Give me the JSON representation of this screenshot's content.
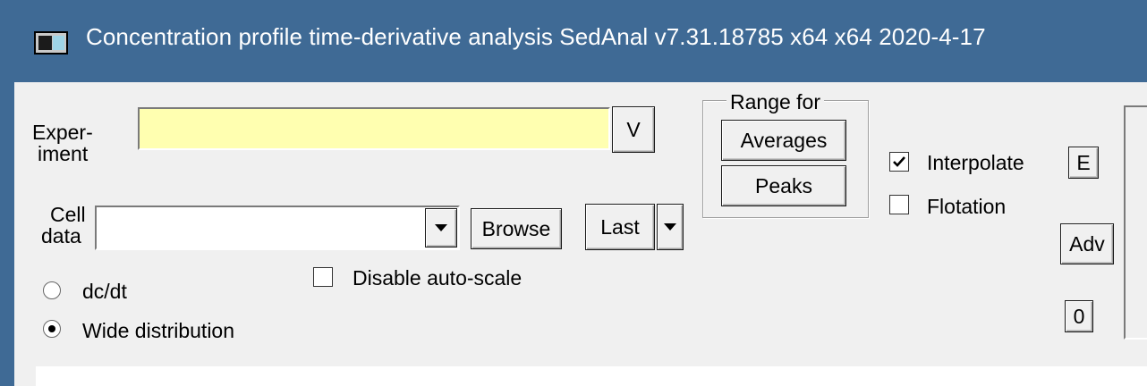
{
  "window": {
    "title": "Concentration profile time-derivative analysis   SedAnal v7.31.18785 x64 x64 2020-4-17"
  },
  "experiment": {
    "label_line1": "Exper-",
    "label_line2": "iment",
    "value": "",
    "v_button": "V"
  },
  "cell_data": {
    "label_line1": "Cell",
    "label_line2": "data",
    "value": "",
    "browse_button": "Browse",
    "last_button": "Last"
  },
  "range_for": {
    "legend": "Range for",
    "averages_button": "Averages",
    "peaks_button": "Peaks"
  },
  "options": {
    "interpolate": {
      "label": "Interpolate",
      "checked": true
    },
    "flotation": {
      "label": "Flotation",
      "checked": false
    },
    "disable_autoscale": {
      "label": "Disable auto-scale",
      "checked": false
    }
  },
  "mode": {
    "dcdt": {
      "label": "dc/dt",
      "selected": false
    },
    "wide": {
      "label": "Wide distribution",
      "selected": true
    }
  },
  "side_buttons": {
    "e": "E",
    "adv": "Adv",
    "zero": "0"
  }
}
